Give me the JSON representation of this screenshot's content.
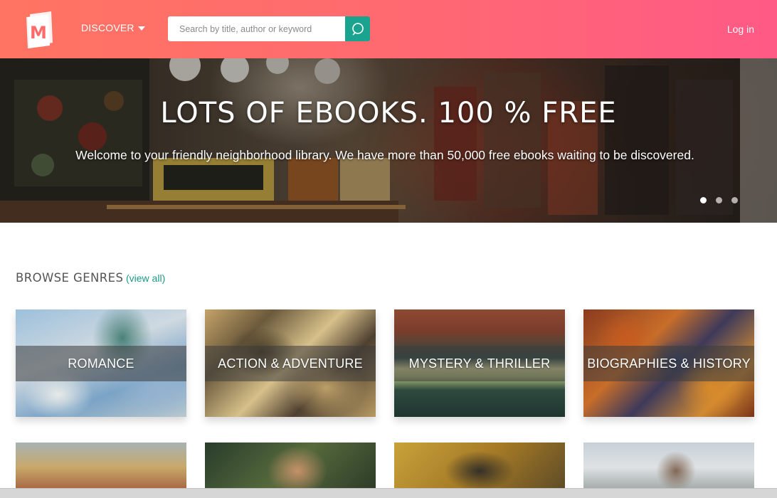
{
  "header": {
    "logo_icon": "book-m-logo-icon",
    "discover_label": "DISCOVER",
    "search": {
      "placeholder": "Search by title, author or keyword",
      "value": ""
    },
    "search_icon": "search-icon",
    "login_label": "Log in",
    "colors": {
      "gradient_start": "#ff7462",
      "gradient_end": "#ff5a86",
      "search_button": "#1aa38e"
    }
  },
  "hero": {
    "title": "LOTS OF EBOOKS. 100 % FREE",
    "subtitle": "Welcome to your friendly neighborhood library. We have more than 50,000 free ebooks waiting to be discovered.",
    "slides": 3,
    "active_slide": 1
  },
  "genres": {
    "title": "BROWSE GENRES",
    "view_all": "(view all)",
    "items": [
      {
        "label": "ROMANCE"
      },
      {
        "label": "ACTION & ADVENTURE"
      },
      {
        "label": "MYSTERY & THRILLER"
      },
      {
        "label": "BIOGRAPHIES & HISTORY"
      }
    ]
  }
}
